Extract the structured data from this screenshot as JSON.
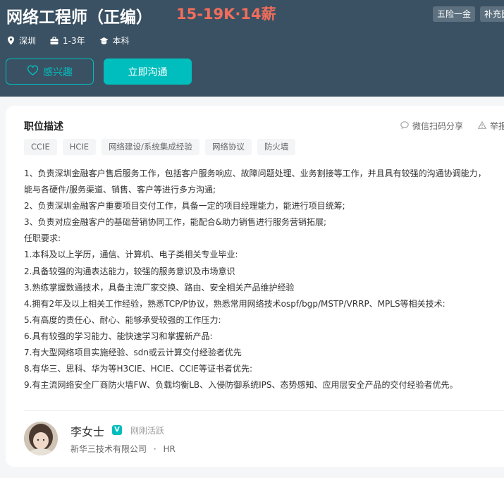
{
  "job": {
    "title": "网络工程师（正编）",
    "salary": "15-19K·14薪",
    "benefits": [
      "五险一金",
      "补充医"
    ],
    "location": "深圳",
    "experience": "1-3年",
    "education": "本科"
  },
  "actions": {
    "interest_label": "感兴趣",
    "chat_label": "立即沟通"
  },
  "description": {
    "section_title": "职位描述",
    "share_label": "微信扫码分享",
    "report_label": "举报",
    "tags": [
      "CCIE",
      "HCIE",
      "网络建设/系统集成经验",
      "网络协议",
      "防火墙"
    ],
    "lines": [
      "1、负责深圳金融客户售后服务工作，包括客户服务响应、故障问题处理、业务割接等工作，并且具有较强的沟通协调能力，",
      "能与各硬件/服务渠道、销售、客户等进行多方沟通;",
      "2、负责深圳金融客户重要项目交付工作，具备一定的项目经理能力，能进行项目统筹;",
      "3、负责对应金融客户的基础营销协同工作，能配合&助力销售进行服务营销拓展;",
      "任职要求:",
      "1.本科及以上学历，通信、计算机、电子类相关专业毕业:",
      "2.具备较强的沟通表达能力，较强的服务意识及市场意识",
      "3.熟练掌握数通技术，具备主流厂家交换、路由、安全相关产品维护经验",
      "4.拥有2年及以上相关工作经验，熟悉TCP/P协议，熟悉常用网络技术ospf/bgp/MSTP/VRRP、MPLS等相关技术:",
      "5.有高度的责任心、耐心、能够承受较强的工作压力:",
      "6.具有较强的学习能力、能快速学习和掌握新产品:",
      "7.有大型网络项目实施经验、sdn或云计算交付经验者优先",
      "8.有华三、思科、华为等H3CIE、HCIE、CCIE等证书者优先:",
      "9.有主流网络安全厂商防火墙FW、负载均衡LB、入侵防御系统IPS、态势感知、应用层安全产品的交付经验者优先。"
    ]
  },
  "recruiter": {
    "name": "李女士",
    "verified_badge": "V",
    "status": "刚刚活跃",
    "company": "新华三技术有限公司",
    "separator": "·",
    "role": "HR"
  },
  "colors": {
    "header_bg": "#3a5163",
    "accent": "#00bebd",
    "salary": "#f26d5b"
  }
}
